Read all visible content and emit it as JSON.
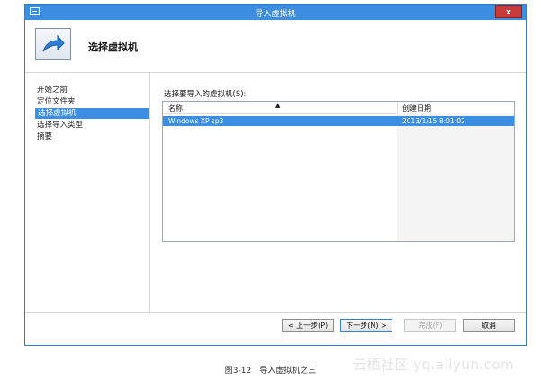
{
  "window": {
    "title": "导入虚拟机",
    "close_label": "x"
  },
  "header": {
    "heading": "选择虚拟机",
    "icon": "wizard-arrow-icon"
  },
  "sidebar": {
    "items": [
      {
        "label": "开始之前",
        "selected": false
      },
      {
        "label": "定位文件夹",
        "selected": false
      },
      {
        "label": "选择虚拟机",
        "selected": true
      },
      {
        "label": "选择导入类型",
        "selected": false
      },
      {
        "label": "摘要",
        "selected": false
      }
    ]
  },
  "main": {
    "list_label": "选择要导入的虚拟机(S):",
    "columns": [
      "名称",
      "创建日期"
    ],
    "sort_indicator": "▲",
    "rows": [
      {
        "name": "Windows XP sp3",
        "created": "2013/1/15 8:01:02",
        "selected": true
      }
    ]
  },
  "buttons": {
    "prev": "< 上一步(P)",
    "next": "下一步(N) >",
    "finish": "完成(F)",
    "cancel": "取消"
  },
  "caption": "图3-12　导入虚拟机之三",
  "watermark": "云栖社区 yq.aliyun.com",
  "colors": {
    "accent": "#3c8ee3",
    "close": "#c83a3a"
  }
}
